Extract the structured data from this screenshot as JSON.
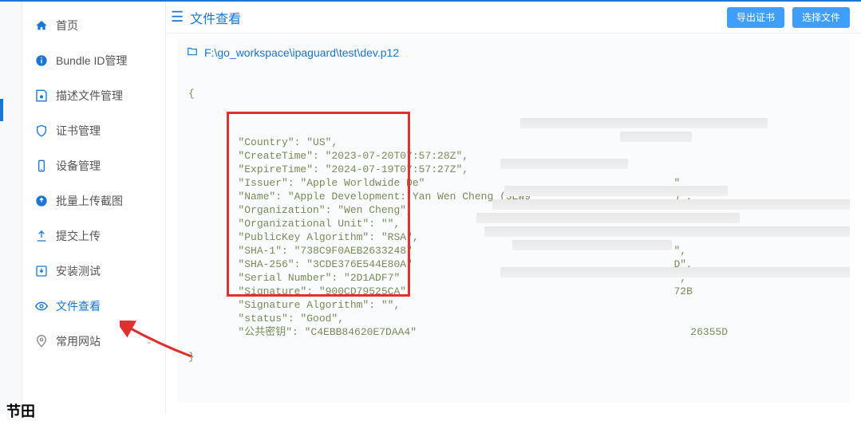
{
  "sidebar": {
    "items": [
      {
        "label": "首页",
        "icon": "home"
      },
      {
        "label": "Bundle ID管理",
        "icon": "info"
      },
      {
        "label": "描述文件管理",
        "icon": "file-gear"
      },
      {
        "label": "证书管理",
        "icon": "shield"
      },
      {
        "label": "设备管理",
        "icon": "device"
      },
      {
        "label": "批量上传截图",
        "icon": "upload-image"
      },
      {
        "label": "提交上传",
        "icon": "upload"
      },
      {
        "label": "安装测试",
        "icon": "install"
      },
      {
        "label": "文件查看",
        "icon": "eye"
      },
      {
        "label": "常用网站",
        "icon": "location",
        "has_chevron": true
      }
    ],
    "active_index": 8
  },
  "header": {
    "title": "文件查看",
    "buttons": {
      "export": "导出证书",
      "select": "选择文件"
    }
  },
  "path": "F:\\go_workspace\\ipaguard\\test\\dev.p12",
  "cert": {
    "Country": "US",
    "CreateTime": "2023-07-20T07:57:28Z",
    "ExpireTime": "2024-07-19T07:57:27Z",
    "Issuer": "Apple Worldwide De",
    "Name": "Apple Development: Yan Wen Cheng (3EW9",
    "Organization": "Wen Cheng",
    "Organizational Unit": "",
    "PublicKey Algorithm": "RSA",
    "SHA-1": "738C9F0AEB2633248",
    "SHA-256": "3CDE376E544E80A",
    "Serial Number": "2D1ADF7",
    "Signature": "900CD79525CA",
    "Signature Algorithm": "",
    "status": "Good",
    "公共密钥": "C4EBB84620E7DAA4"
  },
  "trailing": {
    "Issuer": "\"",
    "Name": ")\",",
    "SHA-1": "\",",
    "SHA-256": "D\",",
    "Serial Number": "\",",
    "Signature": "72B",
    "公共密钥": "26355D"
  },
  "bottom_text": "节田",
  "colors": {
    "accent": "#1976d2",
    "json_text": "#7a8a5a",
    "highlight": "#e03030"
  }
}
